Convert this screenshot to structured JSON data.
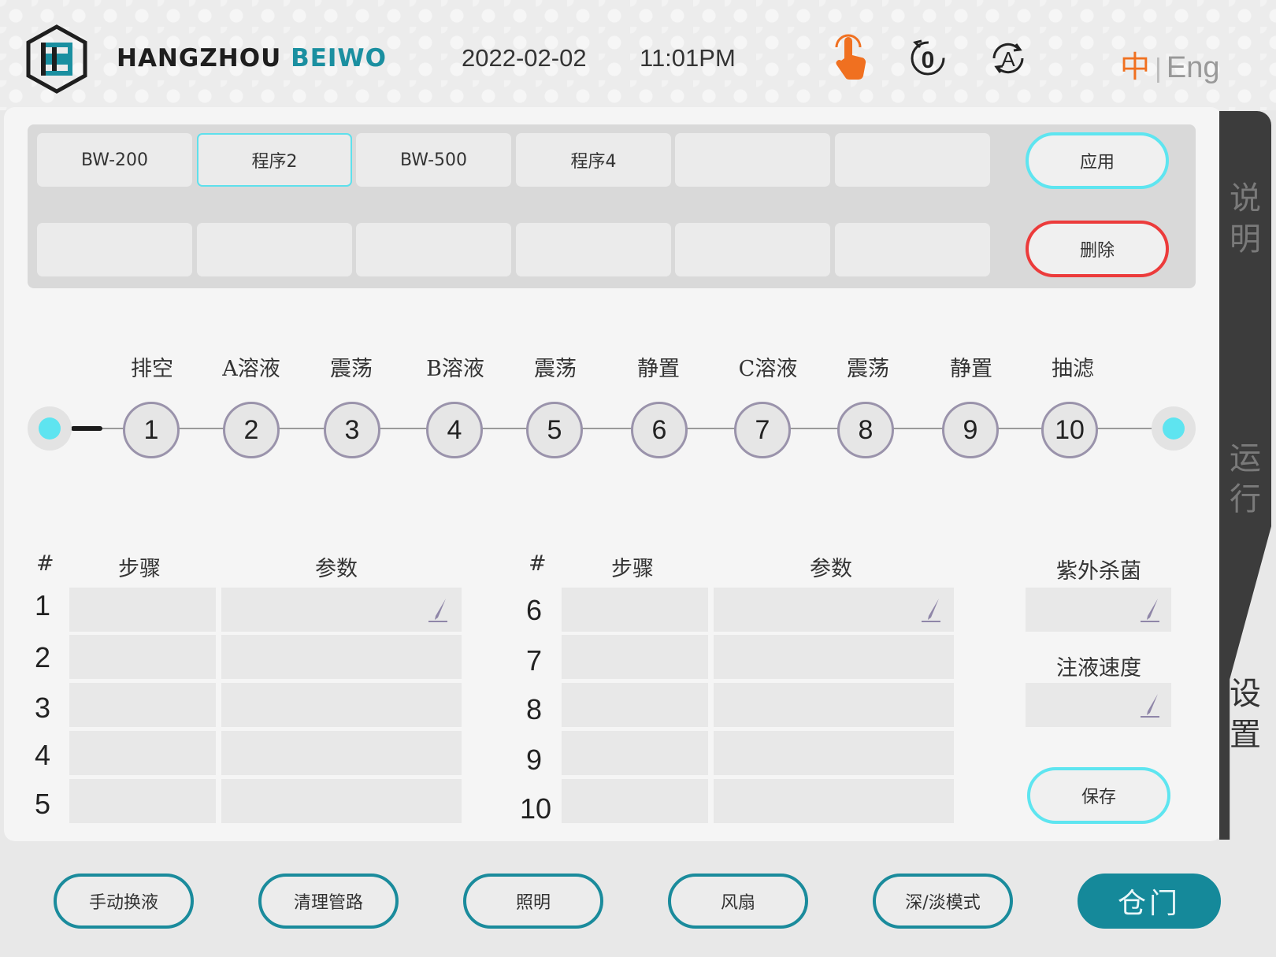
{
  "header": {
    "brand_main": "HANGZHOU",
    "brand_accent": "BEIWO",
    "date": "2022-02-02",
    "time": "11:01PM",
    "icons": [
      "touch-icon",
      "reset-counter-icon",
      "auto-mode-icon"
    ],
    "lang_zh": "中",
    "lang_sep": "|",
    "lang_en": "Eng"
  },
  "sidebar": {
    "tab1": "说\n明",
    "tab2": "运\n行",
    "tab3": "设\n置",
    "active": "设置"
  },
  "programs": {
    "row1": [
      "BW-200",
      "程序2",
      "BW-500",
      "程序4",
      "",
      ""
    ],
    "row2": [
      "",
      "",
      "",
      "",
      "",
      ""
    ],
    "selected": "程序2",
    "apply_label": "应用",
    "delete_label": "删除"
  },
  "steps": {
    "labels": [
      "排空",
      "A溶液",
      "震荡",
      "B溶液",
      "震荡",
      "静置",
      "C溶液",
      "震荡",
      "静置",
      "抽滤"
    ],
    "numbers": [
      "1",
      "2",
      "3",
      "4",
      "5",
      "6",
      "7",
      "8",
      "9",
      "10"
    ]
  },
  "table": {
    "left": {
      "hash": "#",
      "step_header": "步骤",
      "param_header": "参数",
      "rows": [
        "1",
        "2",
        "3",
        "4",
        "5"
      ]
    },
    "right": {
      "hash": "#",
      "step_header": "步骤",
      "param_header": "参数",
      "rows": [
        "6",
        "7",
        "8",
        "9",
        "10"
      ]
    }
  },
  "settings": {
    "uv_label": "紫外杀菌",
    "speed_label": "注液速度",
    "save_label": "保存"
  },
  "footer": {
    "buttons": [
      "手动换液",
      "清理管路",
      "照明",
      "风扇",
      "深/淡模式"
    ],
    "door_label": "仓门"
  },
  "colors": {
    "accent_teal": "#15899a",
    "cyan_border": "#5ee5f0",
    "red_border": "#ec3b3b",
    "touch_orange": "#f07020"
  }
}
